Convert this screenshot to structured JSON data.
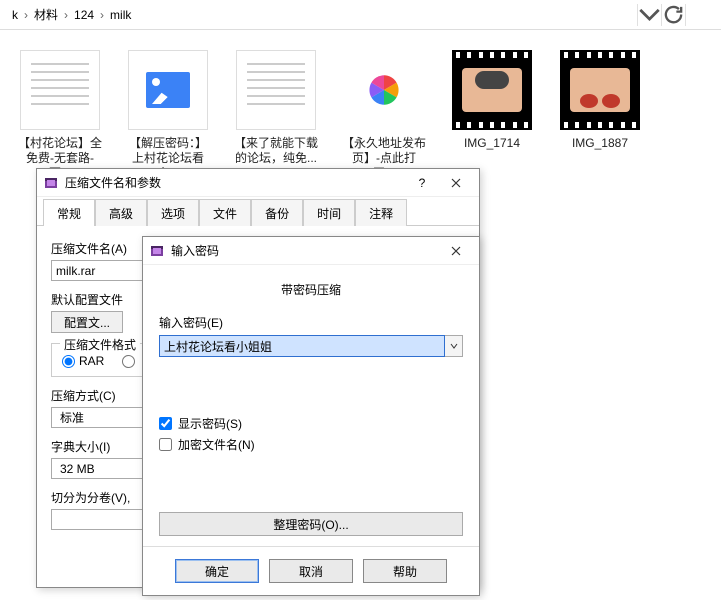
{
  "breadcrumb": {
    "truncated": "k",
    "sep": "›",
    "folder1": "材料",
    "folder2": "124",
    "folder3": "milk"
  },
  "files": [
    {
      "name": "【村花论坛】全免费-无套路-更...",
      "kind": "doc"
    },
    {
      "name": "【解压密码：】上村花论坛看小...",
      "kind": "img-doc"
    },
    {
      "name": "【来了就能下载的论坛，纯免...",
      "kind": "doc"
    },
    {
      "name": "【永久地址发布页】-点此打开...",
      "kind": "pinwheel"
    },
    {
      "name": "IMG_1714",
      "kind": "video1"
    },
    {
      "name": "IMG_1887",
      "kind": "video2"
    }
  ],
  "dlg1": {
    "title": "压缩文件名和参数",
    "tabs": [
      "常规",
      "高级",
      "选项",
      "文件",
      "备份",
      "时间",
      "注释"
    ],
    "archiveName_label": "压缩文件名(A)",
    "archiveName_value": "milk.rar",
    "defaultProfile_label": "默认配置文件",
    "profiles_btn": "配置文...",
    "format_label": "压缩文件格式",
    "format_opts": [
      "RAR",
      ""
    ],
    "method_label": "压缩方式(C)",
    "method_value": "标准",
    "dict_label": "字典大小(I)",
    "dict_value": "32 MB",
    "split_label": "切分为分卷(V),"
  },
  "dlg2": {
    "title": "输入密码",
    "subtitle": "带密码压缩",
    "pwd_label": "输入密码(E)",
    "pwd_value": "上村花论坛看小姐姐",
    "show_pwd": "显示密码(S)",
    "encrypt_names": "加密文件名(N)",
    "organize_btn": "整理密码(O)...",
    "ok": "确定",
    "cancel": "取消",
    "help": "帮助"
  }
}
